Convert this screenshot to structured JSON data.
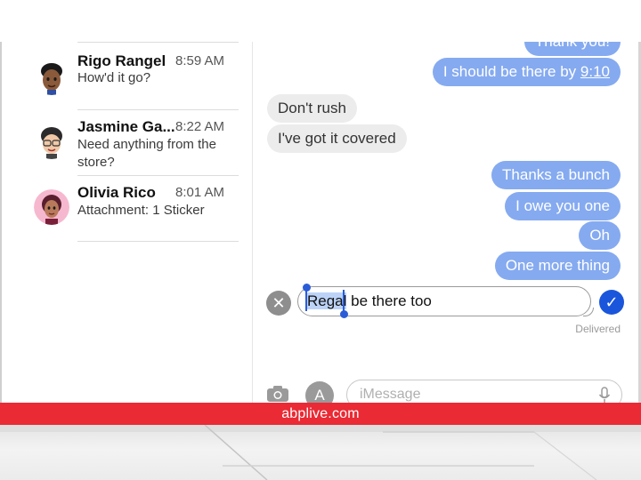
{
  "conversations": [
    {
      "name": "Rigo Rangel",
      "time": "8:59 AM",
      "preview": "How'd it go?"
    },
    {
      "name": "Jasmine Ga...",
      "time": "8:22 AM",
      "preview": "Need anything from the store?"
    },
    {
      "name": "Olivia Rico",
      "time": "8:01 AM",
      "preview": "Attachment: 1 Sticker"
    }
  ],
  "messages": {
    "partial_top": "Thank you!",
    "sent_1_prefix": "I should be there by ",
    "sent_1_time": "9:10",
    "received_1": "Don't rush",
    "received_2": "I've got it covered",
    "sent_2": "Thanks a bunch",
    "sent_3": "I owe you one",
    "sent_4": "Oh",
    "sent_5": "One more thing"
  },
  "edit": {
    "selected_word": "Regal",
    "rest": " be there too",
    "status": "Delivered"
  },
  "composer": {
    "placeholder": "iMessage"
  },
  "watermark": {
    "text": "abplive.com"
  },
  "colors": {
    "sent_bubble": "#85aaf0",
    "received_bubble": "#ececec",
    "confirm_button": "#1a56db",
    "brand_bar": "#ea2a34"
  }
}
